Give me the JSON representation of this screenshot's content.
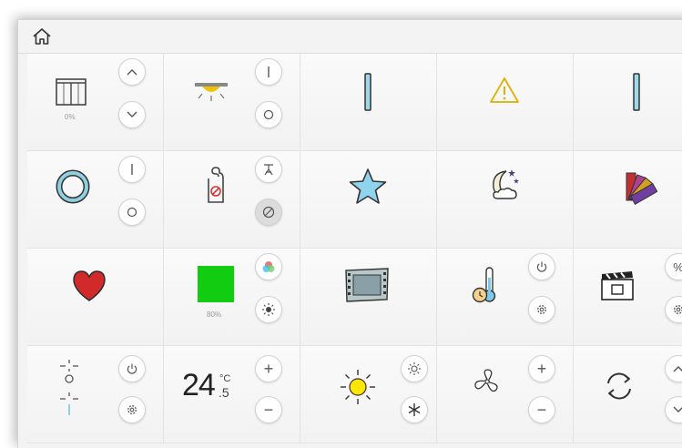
{
  "home_icon": "home-icon",
  "cells": {
    "blind": {
      "icon": "blind-icon",
      "level": "0%",
      "up": "^",
      "down": "v"
    },
    "ceiling_light": {
      "icon": "ceiling-light-icon",
      "on": "I",
      "off": "O"
    },
    "indicator_a": {
      "icon": "bar-indicator-icon"
    },
    "alarm": {
      "icon": "warning-icon"
    },
    "indicator_b": {
      "icon": "bar-indicator-icon"
    },
    "ring": {
      "icon": "ring-icon",
      "on": "I",
      "off": "O"
    },
    "door_hanger": {
      "icon": "do-not-disturb-icon",
      "cleaning": "cleaning-icon",
      "dnd": "no-entry-icon"
    },
    "favourite": {
      "icon": "star-icon"
    },
    "night": {
      "icon": "night-icon"
    },
    "colors": {
      "icon": "color-palette-icon"
    },
    "heart": {
      "icon": "heart-icon"
    },
    "rgb_light": {
      "icon": "color-square-icon",
      "color": "#11cc11",
      "level": "80%",
      "rgb": "rgb-icon",
      "bright": "brightness-icon"
    },
    "film": {
      "icon": "film-strip-icon"
    },
    "thermo_timer": {
      "icon": "thermometer-clock-icon",
      "power": "power-icon",
      "settings": "gear-icon"
    },
    "scene": {
      "icon": "clapperboard-icon",
      "percent": "%",
      "settings": "gear-icon"
    },
    "dimmer": {
      "icon": "dimmer-icon",
      "power": "power-icon",
      "settings": "gear-icon"
    },
    "thermostat": {
      "temperature": "24",
      "decimal": ".5",
      "unit": "°C",
      "plus": "+",
      "minus": "−"
    },
    "climate": {
      "icon": "sun-icon",
      "heat": "sun-small-icon",
      "cool": "snowflake-icon"
    },
    "fan": {
      "icon": "fan-icon",
      "plus": "+",
      "minus": "−"
    },
    "cycle": {
      "icon": "refresh-icon",
      "up": "^",
      "down": "v"
    }
  }
}
